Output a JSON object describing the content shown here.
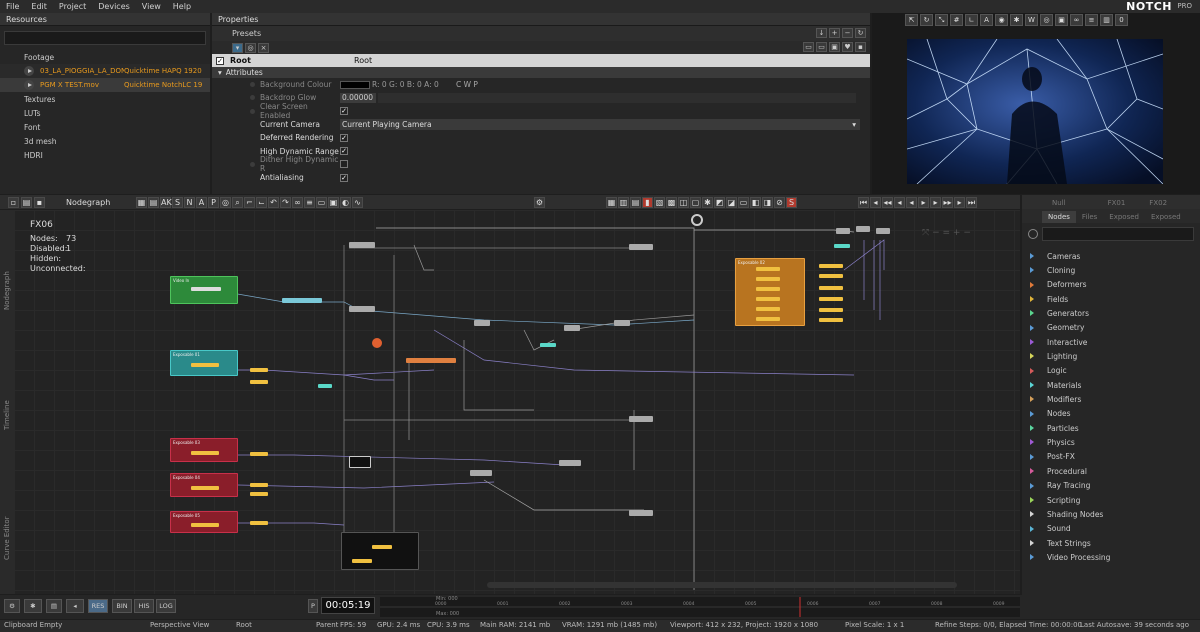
{
  "menu": [
    "File",
    "Edit",
    "Project",
    "Devices",
    "View",
    "Help"
  ],
  "logo": {
    "mark": "NOTCH",
    "pro": "PRO"
  },
  "resources": {
    "title": "Resources",
    "footage_label": "Footage",
    "files": [
      {
        "name": "03_LA_PIOGGIA_LA_DON",
        "codec": "Quicktime HAPQ 1920"
      },
      {
        "name": "PGM X TEST.mov",
        "codec": "Quicktime NotchLC 19"
      }
    ],
    "folders": [
      "Textures",
      "LUTs",
      "Font",
      "3d mesh",
      "HDRI"
    ]
  },
  "properties": {
    "title": "Properties",
    "presets_label": "Presets",
    "root_label": "Root",
    "root_value": "Root",
    "attributes_label": "Attributes",
    "rows": [
      {
        "label": "Background Colour",
        "value": "R: 0 G: 0 B: 0 A: 0",
        "extra": "C   W   P",
        "dim": true
      },
      {
        "label": "Backdrop Glow",
        "value": "0.00000",
        "dim": true
      },
      {
        "label": "Clear Screen Enabled",
        "check": true,
        "dim": false
      },
      {
        "label": "Current Camera",
        "value": "Current Playing Camera",
        "dim": false
      },
      {
        "label": "Deferred Rendering",
        "check": true,
        "dim": false
      },
      {
        "label": "High Dynamic Range",
        "check": true,
        "dim": false
      },
      {
        "label": "Dither High Dynamic R",
        "check": false,
        "dim": true
      },
      {
        "label": "Antialiasing",
        "check": true,
        "dim": false
      }
    ]
  },
  "nodegraph": {
    "title": "Nodegraph",
    "fx": "FX06",
    "stats": [
      {
        "label": "Nodes:",
        "value": "73"
      },
      {
        "label": "Disabled:",
        "value": "1"
      },
      {
        "label": "Hidden:",
        "value": ""
      },
      {
        "label": "Unconnected:",
        "value": ""
      }
    ],
    "toolbar_letters": [
      "AK",
      "S",
      "N",
      "A",
      "P"
    ],
    "side_tabs": [
      "Nodegraph",
      "Timeline",
      "Curve Editor"
    ],
    "groups": [
      {
        "label": "Video In"
      },
      {
        "label": "Exposable 01"
      },
      {
        "label": "Exposable 02"
      },
      {
        "label": "Exposable 03"
      },
      {
        "label": "Exposable 04"
      },
      {
        "label": "Exposable 05"
      }
    ]
  },
  "nodes_panel": {
    "tabs": [
      "Null",
      "FX01",
      "FX02"
    ],
    "sub_tabs": [
      "Nodes",
      "Files",
      "Exposed",
      "Exposed"
    ],
    "header": "Nodes",
    "categories": [
      "Cameras",
      "Cloning",
      "Deformers",
      "Fields",
      "Generators",
      "Geometry",
      "Interactive",
      "Lighting",
      "Logic",
      "Materials",
      "Modifiers",
      "Nodes",
      "Particles",
      "Physics",
      "Post-FX",
      "Procedural",
      "Ray Tracing",
      "Scripting",
      "Shading Nodes",
      "Sound",
      "Text Strings",
      "Video Processing"
    ],
    "category_colors": [
      "#5b9bd5",
      "#5b9bd5",
      "#e07a3a",
      "#e0b43a",
      "#5bd58f",
      "#5b9bd5",
      "#9b5bd5",
      "#d5d55b",
      "#d55b5b",
      "#5bd5d5",
      "#d5a05b",
      "#5b9bd5",
      "#5bd5a0",
      "#a05bd5",
      "#5b9bd5",
      "#d55b9b",
      "#5b9bd5",
      "#9bd55b",
      "#d5d5d5",
      "#5bb4d5",
      "#d5d5d5",
      "#5b9bd5"
    ]
  },
  "bottom": {
    "mode_buttons": [
      "RES",
      "BIN",
      "HIS",
      "LOG"
    ],
    "timecode": "00:05:19",
    "min_label": "Min: 000",
    "max_label": "Max: 000",
    "ticks": [
      "0000",
      "0001",
      "0002",
      "0003",
      "0004",
      "0005",
      "0006",
      "0007",
      "0008",
      "0009"
    ]
  },
  "status": {
    "clipboard": "Clipboard Empty",
    "view": "Perspective View",
    "root": "Root",
    "parent": "Parent",
    "fps": "FPS: 59",
    "gpu": "GPU: 2.4 ms",
    "cpu": "CPU: 3.9 ms",
    "ram": "Main RAM: 2141 mb",
    "vram": "VRAM: 1291 mb (1485 mb)",
    "viewport": "Viewport: 412 x 232, Project: 1920 x 1080",
    "pixel_scale": "Pixel Scale: 1 x 1",
    "refine": "Refine Steps: 0/0, Elapsed Time: 00:00:00",
    "autosave": "Last Autosave: 39 seconds ago"
  }
}
